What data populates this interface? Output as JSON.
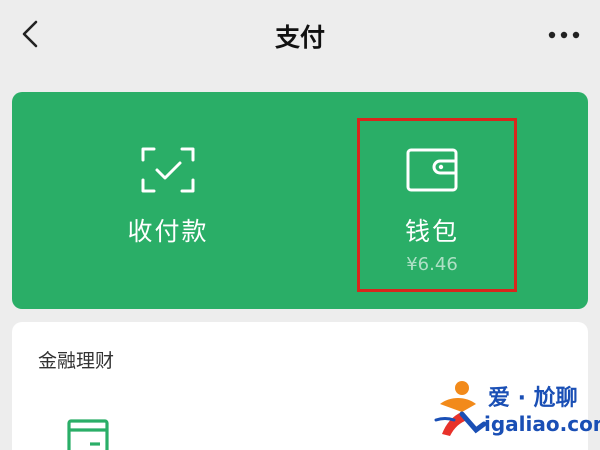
{
  "header": {
    "title": "支付",
    "back_icon": "chevron-left-icon",
    "more_icon": "more-dots-icon"
  },
  "pay_card": {
    "background_color": "#2aae67",
    "receive": {
      "label": "收付款",
      "icon": "scan-check-icon"
    },
    "wallet": {
      "label": "钱包",
      "balance": "¥6.46",
      "icon": "wallet-icon"
    },
    "highlight_color": "#d8261c"
  },
  "finance": {
    "section_title": "金融理财",
    "icon": "finance-card-icon"
  },
  "watermark": {
    "brand": "爱 · 尬聊",
    "url": "igaliao.com",
    "color": "#1a4fb5"
  }
}
